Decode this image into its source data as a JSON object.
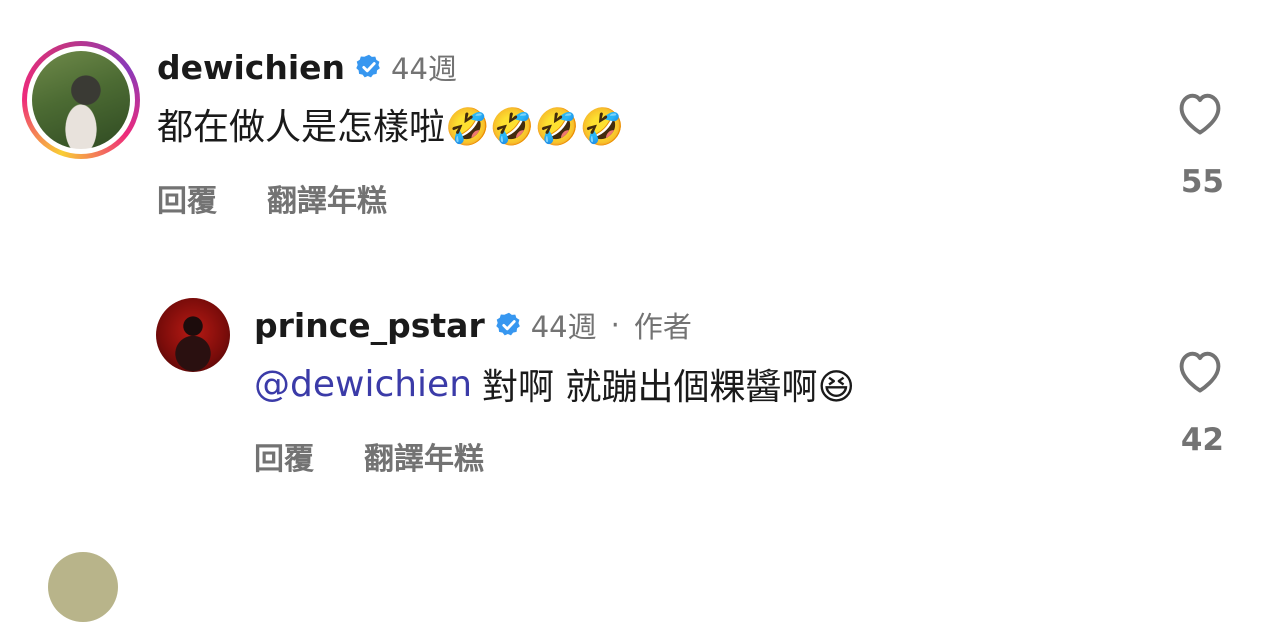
{
  "comments": [
    {
      "username": "dewichien",
      "time": "44週",
      "author_label": "",
      "mention": "",
      "text": "都在做人是怎樣啦🤣🤣🤣🤣",
      "reply_label": "回覆",
      "translate_label": "翻譯年糕",
      "likes": "55"
    },
    {
      "username": "prince_pstar",
      "time": "44週",
      "dot": "·",
      "author_label": "作者",
      "mention": "@dewichien",
      "text": "對啊 就蹦出個粿醬啊😆",
      "reply_label": "回覆",
      "translate_label": "翻譯年糕",
      "likes": "42"
    }
  ],
  "colors": {
    "verified": "#3797f0",
    "mention": "#3b3ba8",
    "muted": "#737373"
  },
  "icons": [
    "verified-badge-icon",
    "heart-icon"
  ]
}
